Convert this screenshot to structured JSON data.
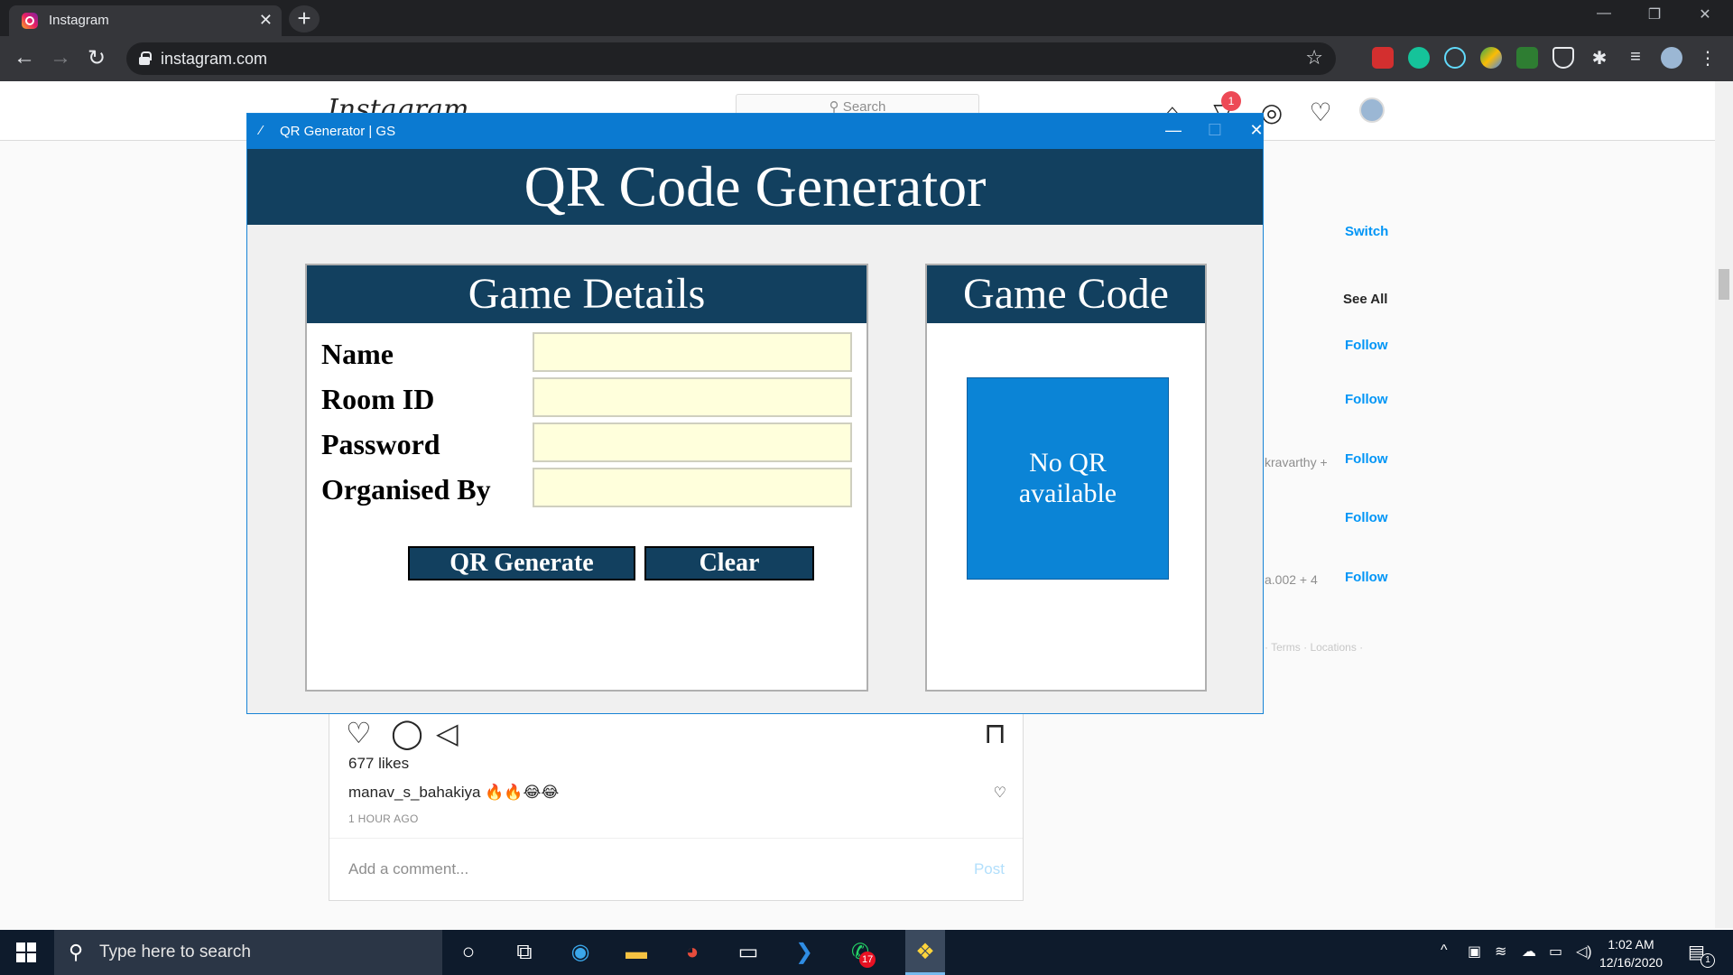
{
  "browser": {
    "tab_title": "Instagram",
    "tab_close": "✕",
    "new_tab": "+",
    "url": "instagram.com",
    "window_controls": [
      "—",
      "❐",
      "✕"
    ]
  },
  "instagram": {
    "logo": "Instagram",
    "search_placeholder": "⚲ Search",
    "notification_count": "1",
    "sidebar": {
      "switch": "Switch",
      "see_all": "See All",
      "follow": "Follow",
      "suggestion_fragment_1": "kravarthy +",
      "suggestion_fragment_2": "a.002 + 4",
      "footer": "· Terms · Locations ·"
    },
    "post": {
      "likes": "677 likes",
      "caption_user": "manav_s_bahakiya",
      "caption_emoji": "🔥🔥😂😂",
      "time": "1 HOUR AGO",
      "comment_placeholder": "Add a comment...",
      "post_button": "Post"
    }
  },
  "qr_app": {
    "window_title": "QR Generator | GS",
    "heading": "QR Code Generator",
    "details_panel_title": "Game Details",
    "code_panel_title": "Game Code",
    "fields": [
      {
        "label": "Name",
        "value": ""
      },
      {
        "label": "Room ID",
        "value": ""
      },
      {
        "label": "Password",
        "value": ""
      },
      {
        "label": "Organised By",
        "value": ""
      }
    ],
    "generate_button": "QR Generate",
    "clear_button": "Clear",
    "qr_placeholder_line1": "No QR",
    "qr_placeholder_line2": "available",
    "qr_box_color": "#0b84d6",
    "header_color": "#12405f",
    "input_bg_color": "#ffffdc"
  },
  "taskbar": {
    "search_placeholder": "Type here to search",
    "time": "1:02 AM",
    "date": "12/16/2020",
    "whatsapp_badge": "17",
    "notification_badge": "1"
  }
}
